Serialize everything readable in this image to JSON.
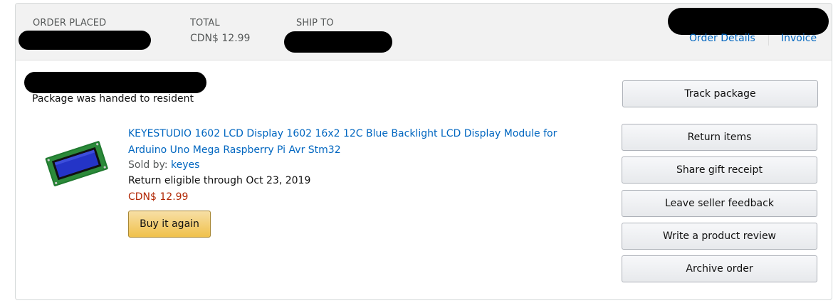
{
  "header": {
    "order_placed_label": "ORDER PLACED",
    "total_label": "TOTAL",
    "total_value": "CDN$ 12.99",
    "ship_to_label": "SHIP TO",
    "order_details_link": "Order Details",
    "invoice_link": "Invoice"
  },
  "shipment": {
    "status_text": "Package was handed to resident"
  },
  "item": {
    "title_line1": "KEYESTUDIO 1602 LCD Display 1602 16x2 12C Blue Backlight LCD Display Module for",
    "title_line2": "Arduino Uno Mega Raspberry Pi Avr Stm32",
    "sold_by_label": "Sold by:",
    "seller": "keyes",
    "return_eligible": "Return eligible through Oct 23, 2019",
    "price": "CDN$ 12.99",
    "buy_again_label": "Buy it again"
  },
  "actions": {
    "track_package": "Track package",
    "return_items": "Return items",
    "share_gift_receipt": "Share gift receipt",
    "leave_seller_feedback": "Leave seller feedback",
    "write_product_review": "Write a product review",
    "archive_order": "Archive order"
  },
  "colors": {
    "link": "#0066c0",
    "price": "#b12704",
    "header_bg": "#f2f2f2",
    "buy_button": "#f0c14b"
  },
  "icons": {
    "product_image": "lcd-display-module-image"
  }
}
